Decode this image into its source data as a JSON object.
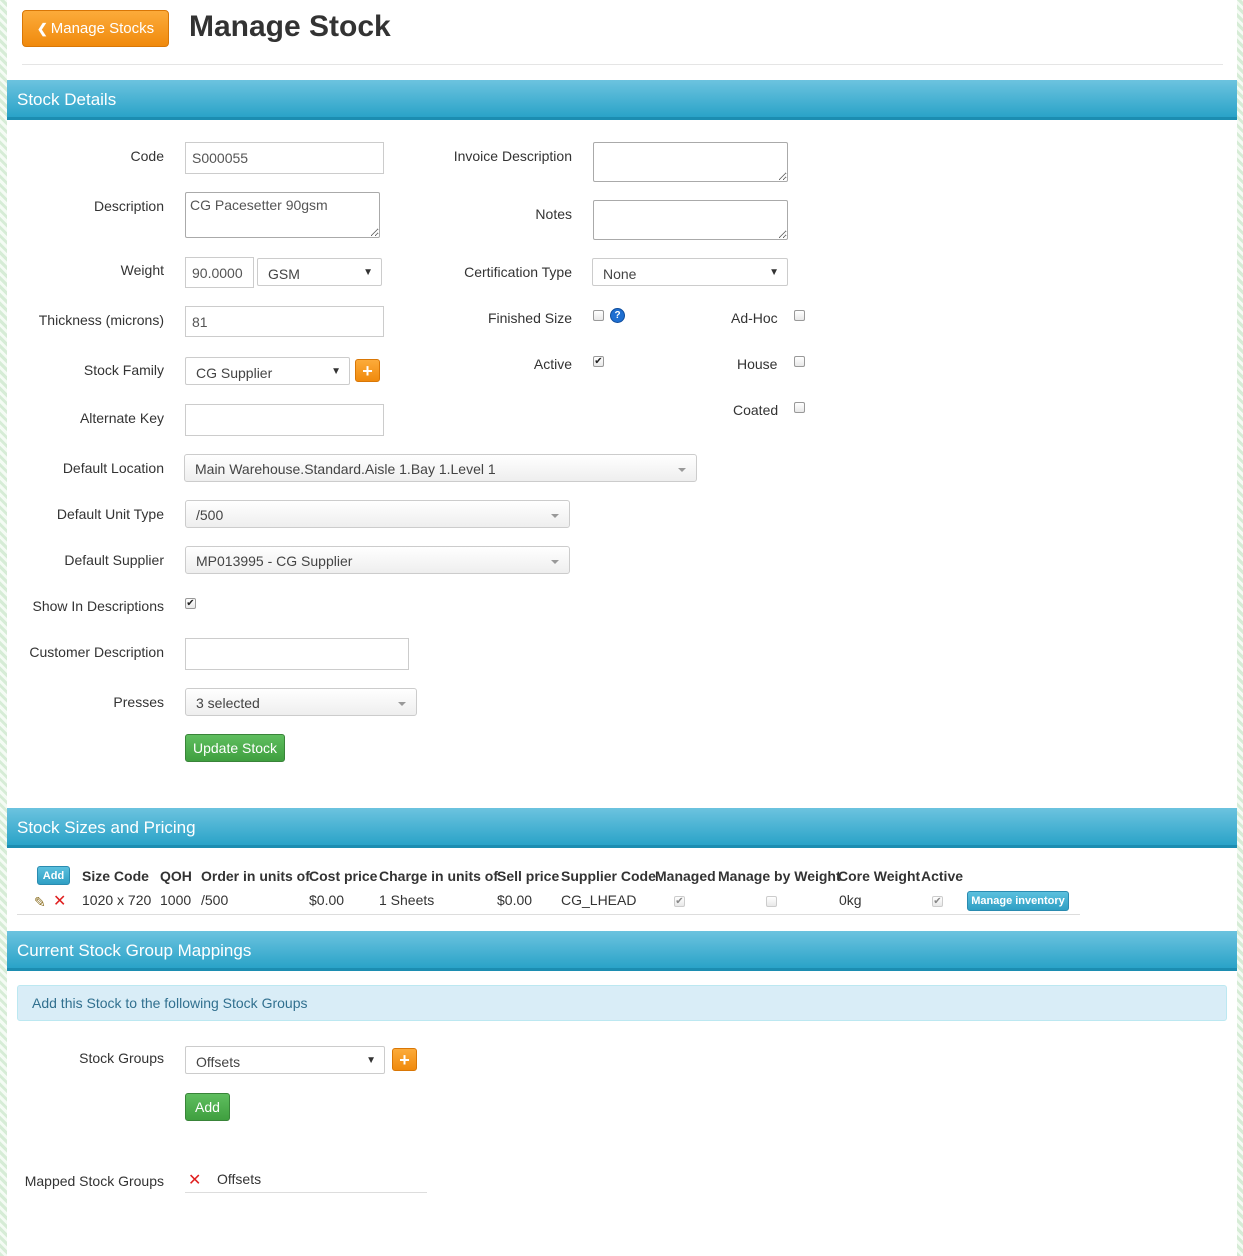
{
  "header": {
    "back_label": "Manage Stocks",
    "title": "Manage Stock"
  },
  "sections": {
    "details": "Stock Details",
    "sizes": "Stock Sizes and Pricing",
    "groups": "Current Stock Group Mappings"
  },
  "form": {
    "code_label": "Code",
    "code_value": "S000055",
    "description_label": "Description",
    "description_value": "CG Pacesetter 90gsm",
    "weight_label": "Weight",
    "weight_value": "90.0000",
    "weight_unit": "GSM",
    "thickness_label": "Thickness (microns)",
    "thickness_value": "81",
    "family_label": "Stock Family",
    "family_value": "CG Supplier",
    "alternate_key_label": "Alternate Key",
    "alternate_key_value": "",
    "location_label": "Default Location",
    "location_value": "Main Warehouse.Standard.Aisle 1.Bay 1.Level 1",
    "unit_type_label": "Default Unit Type",
    "unit_type_value": "/500",
    "supplier_label": "Default Supplier",
    "supplier_value": "MP013995 - CG Supplier",
    "show_in_desc_label": "Show In Descriptions",
    "show_in_desc_checked": true,
    "customer_desc_label": "Customer Description",
    "customer_desc_value": "",
    "presses_label": "Presses",
    "presses_value": "3 selected",
    "update_button": "Update Stock",
    "invoice_desc_label": "Invoice Description",
    "invoice_desc_value": "",
    "notes_label": "Notes",
    "notes_value": "",
    "cert_type_label": "Certification Type",
    "cert_type_value": "None",
    "finished_size_label": "Finished Size",
    "finished_size_checked": false,
    "active_label": "Active",
    "active_checked": true,
    "adhoc_label": "Ad-Hoc",
    "adhoc_checked": false,
    "house_label": "House",
    "house_checked": false,
    "coated_label": "Coated",
    "coated_checked": false
  },
  "sizes_table": {
    "add_button": "Add",
    "columns": [
      "Size Code",
      "QOH",
      "Order in units of",
      "Cost price",
      "Charge in units of",
      "Sell price",
      "Supplier Code",
      "Managed",
      "Manage by Weight",
      "Core Weight",
      "Active"
    ],
    "row": {
      "size_code": "1020 x 720",
      "qoh": "1000",
      "order_units": "/500",
      "cost_price": "$0.00",
      "charge_units": "1 Sheets",
      "sell_price": "$0.00",
      "supplier_code": "CG_LHEAD",
      "managed": true,
      "manage_by_weight": false,
      "core_weight": "0kg",
      "active": true,
      "manage_inventory_button": "Manage inventory"
    }
  },
  "groups": {
    "info_text": "Add this Stock to the following Stock Groups",
    "groups_label": "Stock Groups",
    "groups_value": "Offsets",
    "add_button": "Add",
    "mapped_label": "Mapped Stock Groups",
    "mapped_items": [
      "Offsets"
    ]
  },
  "colors": {
    "section_bar": "#2aa3c8",
    "orange_button": "#f08a0d",
    "green_button": "#3f9f3f",
    "info_bg": "#d9edf7"
  }
}
